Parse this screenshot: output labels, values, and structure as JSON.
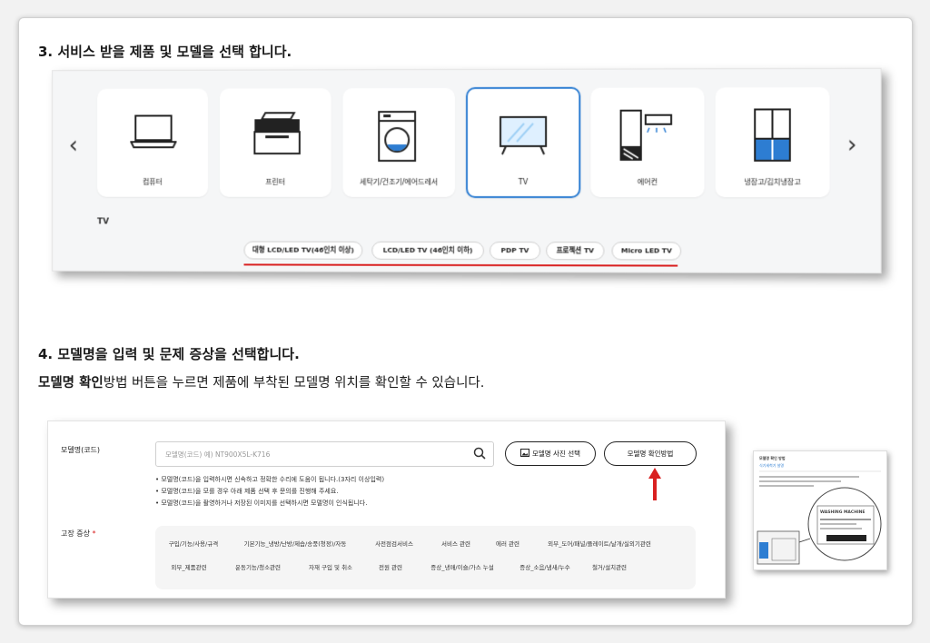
{
  "step3": {
    "title": "3. 서비스 받을 제품 및 모델을 선택 합니다."
  },
  "products": [
    {
      "label": "컴퓨터",
      "icon": "laptop-icon"
    },
    {
      "label": "프린터",
      "icon": "printer-icon"
    },
    {
      "label": "세탁기/건조기/에어드레서",
      "icon": "washer-icon"
    },
    {
      "label": "TV",
      "icon": "tv-icon",
      "selected": true
    },
    {
      "label": "에어컨",
      "icon": "air-conditioner-icon"
    },
    {
      "label": "냉장고/김치냉장고",
      "icon": "refrigerator-icon"
    }
  ],
  "nav": {
    "prev": "‹",
    "next": "›"
  },
  "category_label": "TV",
  "subcategories": [
    "대형 LCD/LED TV(46인치 이상)",
    "LCD/LED TV (46인치 이하)",
    "PDP TV",
    "프로젝션 TV",
    "Micro LED TV"
  ],
  "step4": {
    "title": "4. 모델명을 입력 및 문제 증상을 선택합니다.",
    "desc_bold": "모델명 확인",
    "desc_rest": "방법 버튼을 누르면 제품에 부착된 모델명 위치를 확인할 수 있습니다."
  },
  "form": {
    "model_label": "모델명(코드)",
    "model_placeholder": "모델명(코드) 예) NT900X5L-K716",
    "photo_button": "모델명 사진 선택",
    "howto_button": "모델명 확인방법",
    "notes": [
      "• 모델명(코드)을 입력하시면 신속하고 정확한 수리에 도움이 됩니다.(3자리 이상입력)",
      "• 모델명(코드)을 모를 경우 아래 제품 선택 후 문의를 진행해 주세요.",
      "• 모델명(코드)을 촬영하거나 저장된 이미지를 선택하시면 모델명이 인식됩니다."
    ],
    "symptom_label": "고장 증상",
    "required_mark": "*",
    "symptoms_row1": [
      "구입/기능/사용/규격",
      "기본기능_냉방/난방/제습/송풍(청정)/자동",
      "사전점검서비스",
      "서비스 관련",
      "에러 관련",
      "외부_도어/패널/플레이트/날개/실외기관련"
    ],
    "symptoms_row2": [
      "외부_제품관련",
      "운동기능/청소관련",
      "자재 구입 및 취소",
      "전원 관련",
      "증상_냉매/이슬/가스 누설",
      "증상_소음/냄새/누수",
      "철거/설치관련"
    ]
  },
  "label_image": {
    "heading": "모델명 확인 방법",
    "sub": "식기세척기 설명",
    "plate": "WASHING MACHINE"
  },
  "colors": {
    "accent": "#2d7dd2",
    "underline": "#d92020"
  }
}
